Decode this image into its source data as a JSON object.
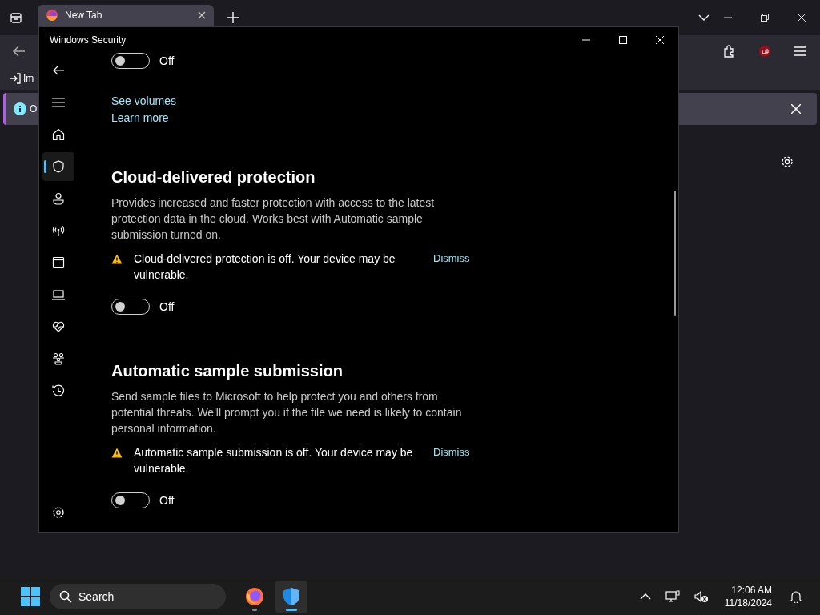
{
  "browser": {
    "tabs": [
      {
        "label": "New Tab",
        "selected": true
      }
    ],
    "bookmark": "Im",
    "notice": "O"
  },
  "security": {
    "title": "Windows Security",
    "nav": [
      {
        "kind": "back",
        "selected": false
      },
      {
        "kind": "menu",
        "selected": false
      },
      {
        "kind": "home",
        "selected": false
      },
      {
        "kind": "shield",
        "selected": true
      },
      {
        "kind": "person",
        "selected": false
      },
      {
        "kind": "antenna",
        "selected": false
      },
      {
        "kind": "app",
        "selected": false
      },
      {
        "kind": "laptop",
        "selected": false
      },
      {
        "kind": "heart",
        "selected": false
      },
      {
        "kind": "family",
        "selected": false
      },
      {
        "kind": "history",
        "selected": false
      },
      {
        "kind": "settings",
        "selected": false
      }
    ],
    "top": {
      "toggle": {
        "on": false,
        "label": "Off"
      },
      "links": [
        "See volumes",
        "Learn more"
      ]
    },
    "sections": [
      {
        "title": "Cloud-delivered protection",
        "description": "Provides increased and faster protection with access to the latest protection data in the cloud. Works best with Automatic sample submission turned on.",
        "warning": "Cloud-delivered protection is off. Your device may be vulnerable.",
        "dismiss": "Dismiss",
        "toggle": {
          "on": false,
          "label": "Off"
        }
      },
      {
        "title": "Automatic sample submission",
        "description": "Send sample files to Microsoft to help protect you and others from potential threats. We'll prompt you if the file we need is likely to contain personal information.",
        "warning": "Automatic sample submission is off. Your device may be vulnerable.",
        "dismiss": "Dismiss",
        "toggle": {
          "on": false,
          "label": "Off"
        }
      }
    ]
  },
  "taskbar": {
    "search": {
      "placeholder": "Search"
    },
    "apps": [
      {
        "kind": "firefox",
        "active": false
      },
      {
        "kind": "shield",
        "active": true
      }
    ],
    "time": "12:06 AM",
    "date": "11/18/2024"
  }
}
